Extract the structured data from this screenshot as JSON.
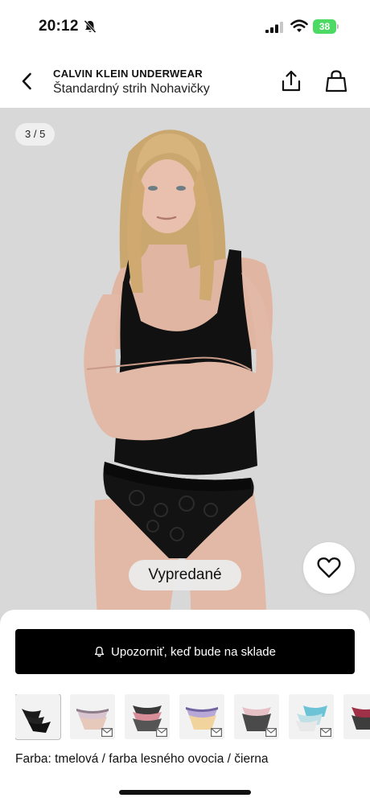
{
  "status_bar": {
    "time": "20:12",
    "battery": "38"
  },
  "header": {
    "brand": "CALVIN KLEIN UNDERWEAR",
    "product_name": "Štandardný strih Nohavičky"
  },
  "gallery": {
    "counter": "3 / 5",
    "sold_out_label": "Vypredané"
  },
  "actions": {
    "notify_label": "Upozorniť, keď bude na sklade"
  },
  "color": {
    "label": "Farba: tmelová / farba lesného ovocia / čierna"
  },
  "colors": {
    "accent": "#000000",
    "battery": "#4cd964",
    "image_bg": "#d8d8d8"
  }
}
